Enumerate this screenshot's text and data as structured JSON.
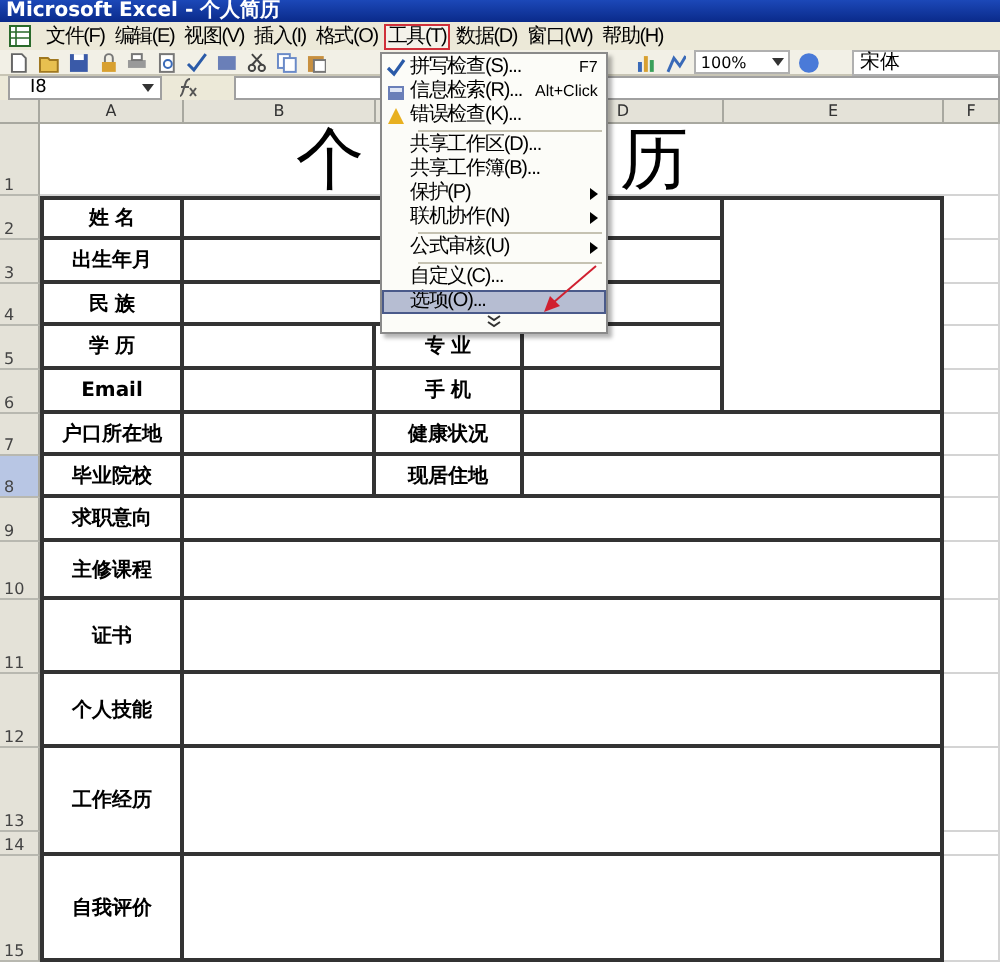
{
  "window": {
    "title": "Microsoft Excel - 个人简历"
  },
  "menu_bar": [
    {
      "label": "文件(F)",
      "selected": false
    },
    {
      "label": "编辑(E)",
      "selected": false
    },
    {
      "label": "视图(V)",
      "selected": false
    },
    {
      "label": "插入(I)",
      "selected": false
    },
    {
      "label": "格式(O)",
      "selected": false
    },
    {
      "label": "工具(T)",
      "selected": true
    },
    {
      "label": "数据(D)",
      "selected": false
    },
    {
      "label": "窗口(W)",
      "selected": false
    },
    {
      "label": "帮助(H)",
      "selected": false
    }
  ],
  "tools_menu": {
    "groups": [
      [
        {
          "label": "拼写检查(S)...",
          "shortcut": "F7",
          "submenu": false,
          "selected": false
        },
        {
          "label": "信息检索(R)...",
          "shortcut": "Alt+Click",
          "submenu": false,
          "selected": false
        },
        {
          "label": "错误检查(K)...",
          "submenu": false,
          "selected": false
        }
      ],
      [
        {
          "label": "共享工作区(D)...",
          "submenu": false,
          "selected": false
        },
        {
          "label": "共享工作簿(B)...",
          "submenu": false,
          "selected": false
        },
        {
          "label": "保护(P)",
          "submenu": true,
          "selected": false
        },
        {
          "label": "联机协作(N)",
          "submenu": true,
          "selected": false
        }
      ],
      [
        {
          "label": "公式审核(U)",
          "submenu": true,
          "selected": false
        }
      ],
      [
        {
          "label": "自定义(C)...",
          "submenu": false,
          "selected": false
        },
        {
          "label": "选项(O)...",
          "submenu": false,
          "selected": true
        }
      ]
    ]
  },
  "toolbar": {
    "zoom": "100%",
    "font": "宋体"
  },
  "formula_bar": {
    "name_box": "I8"
  },
  "sheet": {
    "columns": [
      "A",
      "B",
      "D",
      "E",
      "F"
    ],
    "rows": [
      {
        "label": "1",
        "selected": false
      },
      {
        "label": "2",
        "selected": false
      },
      {
        "label": "3",
        "selected": false
      },
      {
        "label": "4",
        "selected": false
      },
      {
        "label": "5",
        "selected": false
      },
      {
        "label": "6",
        "selected": false
      },
      {
        "label": "7",
        "selected": false
      },
      {
        "label": "8",
        "selected": true
      },
      {
        "label": "9",
        "selected": false
      },
      {
        "label": "10",
        "selected": false
      },
      {
        "label": "11",
        "selected": false
      },
      {
        "label": "12",
        "selected": false
      },
      {
        "label": "13",
        "selected": false
      },
      {
        "label": "14",
        "selected": false
      },
      {
        "label": "15",
        "selected": false
      }
    ],
    "title": [
      "个",
      "历"
    ],
    "labels": [
      "姓 名",
      "出生年月",
      "民 族",
      "学 历",
      "专 业",
      "Email",
      "手 机",
      "户口所在地",
      "健康状况",
      "毕业院校",
      "现居住地",
      "求职意向",
      "主修课程",
      "证书",
      "个人技能",
      "工作经历",
      "自我评价"
    ]
  }
}
